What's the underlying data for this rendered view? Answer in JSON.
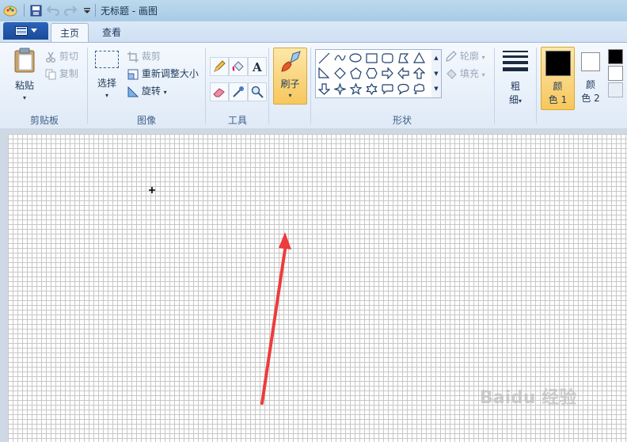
{
  "window": {
    "title": "无标题 - 画图"
  },
  "tabs": [
    {
      "label": "主页",
      "active": true
    },
    {
      "label": "查看",
      "active": false
    }
  ],
  "clipboard": {
    "label": "剪贴板",
    "paste": "粘贴",
    "cut": "剪切",
    "copy": "复制"
  },
  "image": {
    "label": "图像",
    "select": "选择",
    "crop": "裁剪",
    "resize": "重新调整大小",
    "rotate": "旋转"
  },
  "tools": {
    "label": "工具"
  },
  "brushes": {
    "label": "刷子"
  },
  "shapes": {
    "label": "形状",
    "outline": "轮廓",
    "fill": "填充"
  },
  "size": {
    "label_line1": "粗",
    "label_line2": "细"
  },
  "colors": {
    "color1_line1": "颜",
    "color1_line2": "色 1",
    "color2_line1": "颜",
    "color2_line2": "色 2",
    "color1_value": "#000000",
    "color2_value": "#ffffff",
    "accent": "#f7c75c"
  },
  "watermark": "Baidu 经验",
  "annotation": {
    "arrow_color": "#ee3b3b"
  }
}
